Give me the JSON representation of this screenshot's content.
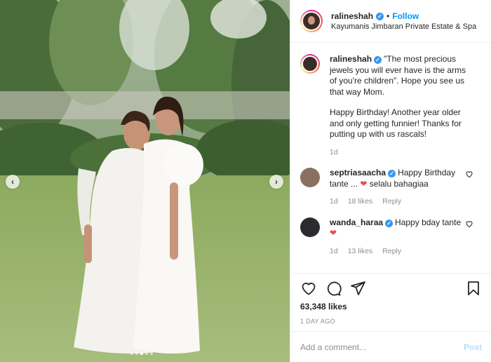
{
  "post": {
    "username": "ralineshah",
    "follow_label": "Follow",
    "separator": "•",
    "location": "Kayumanis Jimbaran Private Estate & Spa"
  },
  "caption": {
    "username": "ralineshah",
    "text1": "\"The most precious jewels you will ever have is the arms of you're children\". Hope you see us that way Mom.",
    "text2": "Happy Birthday! Another year older and only getting funnier! Thanks for putting up with us rascals!",
    "time": "1d"
  },
  "comments": [
    {
      "username": "septriasaacha",
      "text_before": "Happy Birthday tante ...",
      "heart": "❤",
      "text_after": "selalu bahagiaa",
      "time": "1d",
      "likes": "18 likes",
      "reply": "Reply"
    },
    {
      "username": "wanda_haraa",
      "text_before": "Happy bday tante",
      "heart": "❤",
      "text_after": "",
      "time": "1d",
      "likes": "13 likes",
      "reply": "Reply"
    }
  ],
  "likes_count": "63,348 likes",
  "timestamp": "1 DAY AGO",
  "add_comment": {
    "placeholder": "Add a comment...",
    "post_label": "Post"
  },
  "photo_nav": {
    "prev": "‹",
    "next": "›"
  },
  "icons": {
    "like": "heart-icon",
    "comment": "comment-icon",
    "share": "share-icon",
    "save": "bookmark-icon"
  },
  "colors": {
    "accent": "#0095f6",
    "verified": "#3897f0",
    "heart": "#ed4956",
    "muted": "#8e8e8e"
  }
}
